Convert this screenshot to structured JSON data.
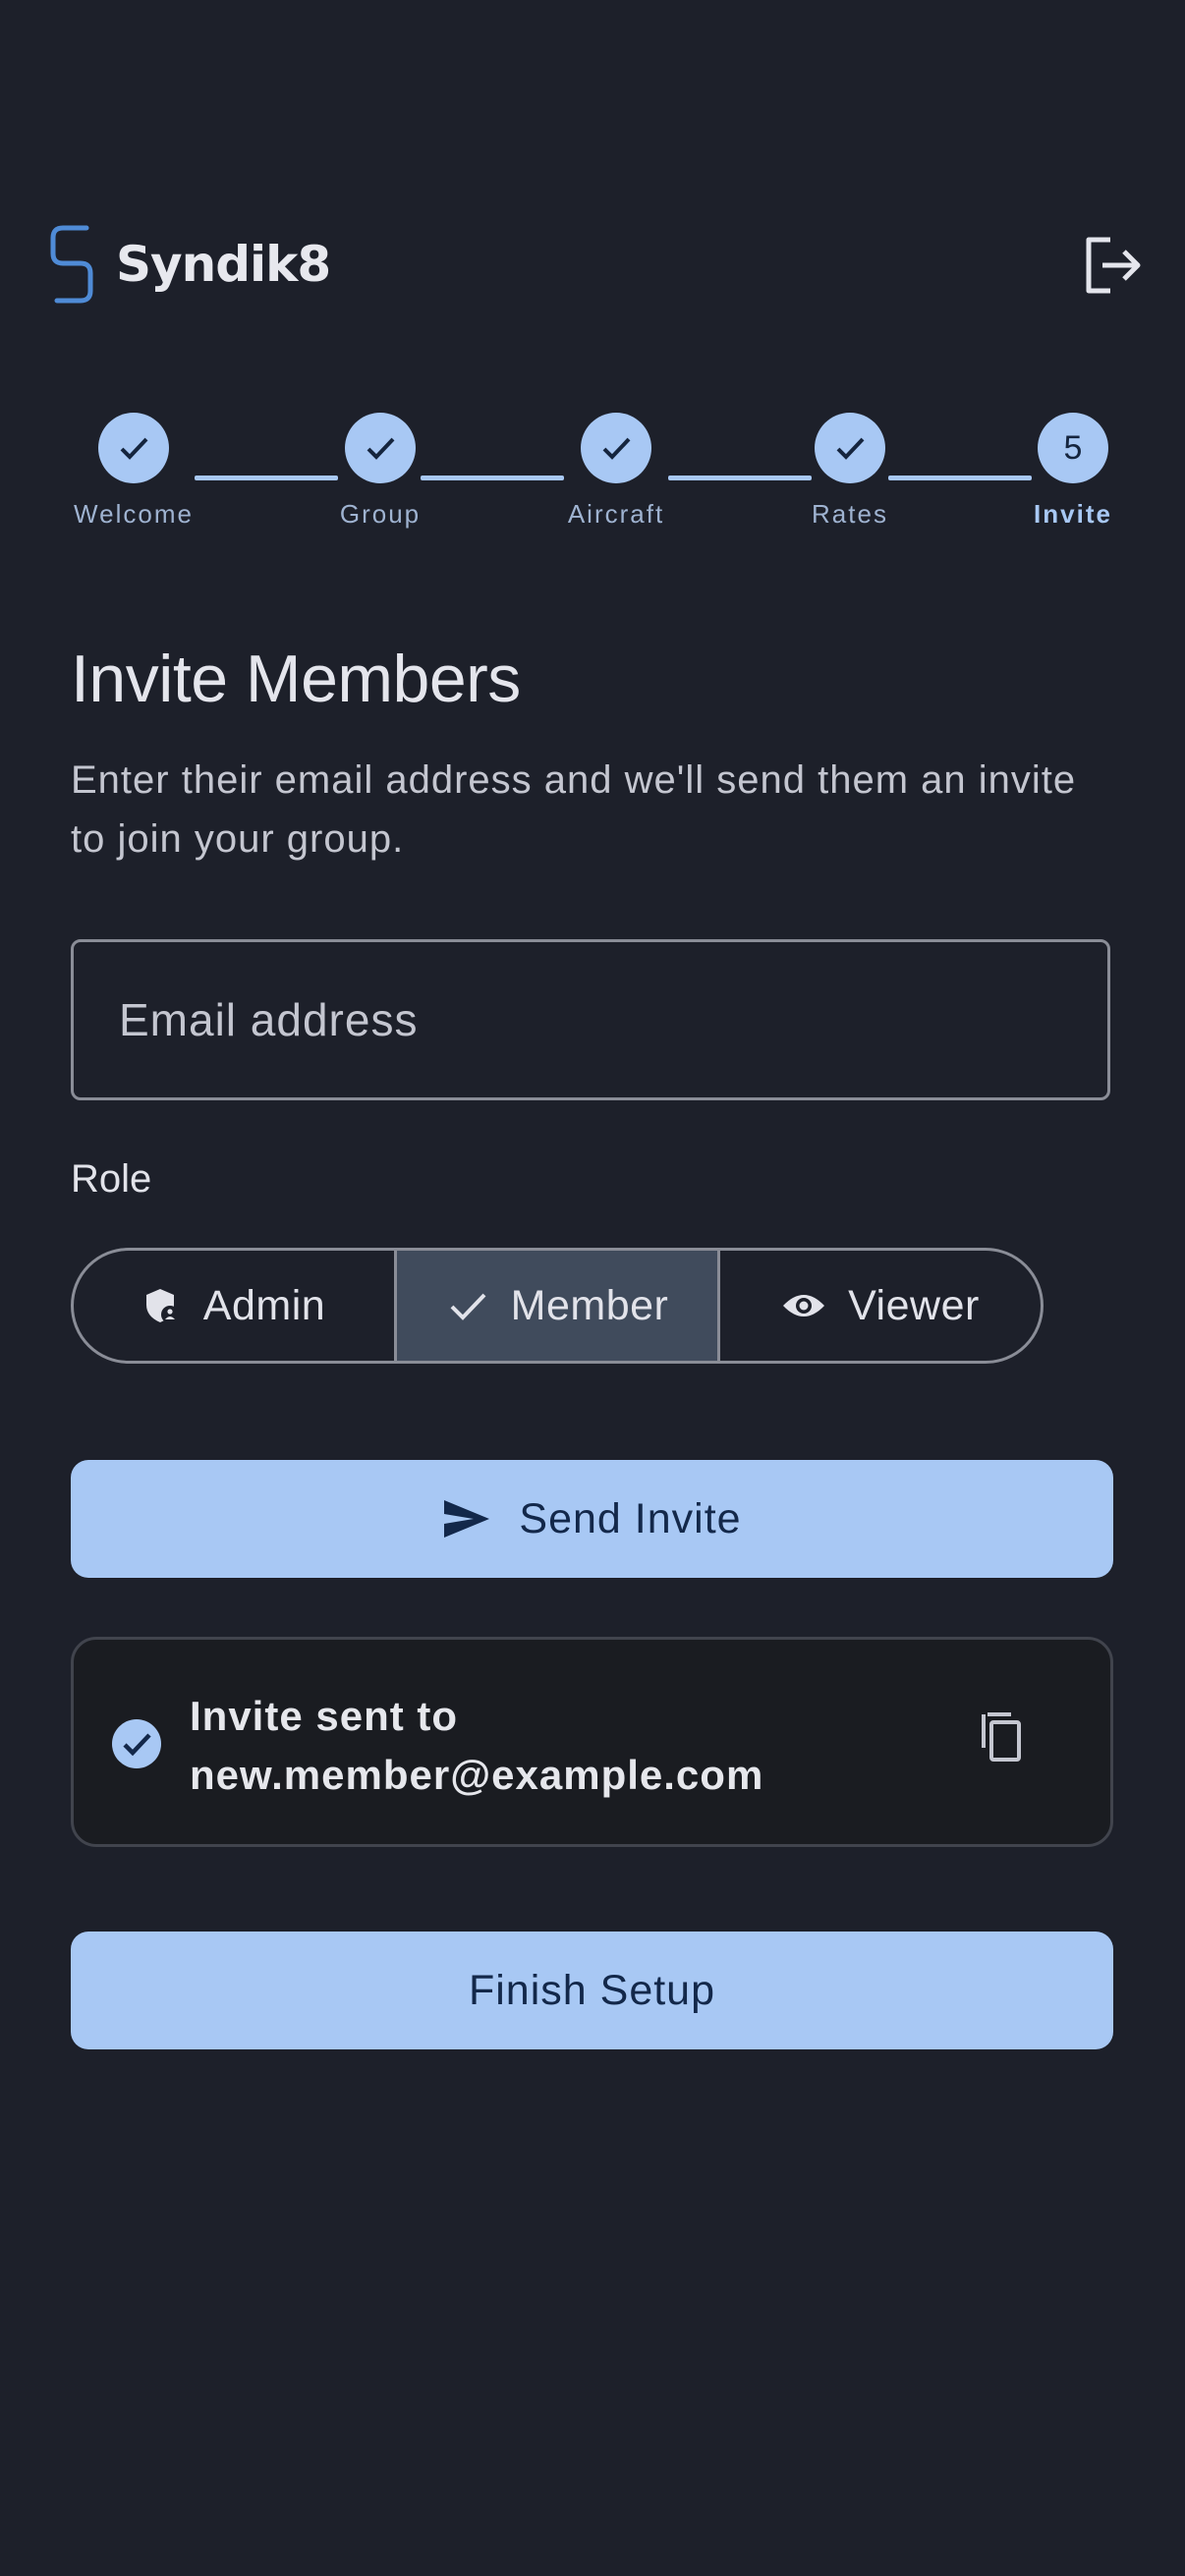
{
  "app": {
    "name": "Syndik8"
  },
  "colors": {
    "accent": "#a8c8f4",
    "background": "#1d202a"
  },
  "stepper": {
    "steps": [
      {
        "label": "Welcome",
        "state": "done",
        "icon": "check-icon"
      },
      {
        "label": "Group",
        "state": "done",
        "icon": "check-icon"
      },
      {
        "label": "Aircraft",
        "state": "done",
        "icon": "check-icon"
      },
      {
        "label": "Rates",
        "state": "done",
        "icon": "check-icon"
      },
      {
        "label": "Invite",
        "state": "active",
        "number": "5"
      }
    ]
  },
  "page": {
    "title": "Invite Members",
    "description": "Enter their email address and we'll send them an invite to join your group."
  },
  "form": {
    "email_placeholder": "Email address",
    "email_value": "",
    "role_label": "Role",
    "roles": [
      {
        "label": "Admin",
        "icon": "admin-shield-icon",
        "selected": false
      },
      {
        "label": "Member",
        "icon": "check-icon",
        "selected": true
      },
      {
        "label": "Viewer",
        "icon": "eye-icon",
        "selected": false
      }
    ],
    "send_label": "Send Invite"
  },
  "notice": {
    "line1": "Invite sent to",
    "line2": "new.member@example.com"
  },
  "finish_label": "Finish Setup"
}
